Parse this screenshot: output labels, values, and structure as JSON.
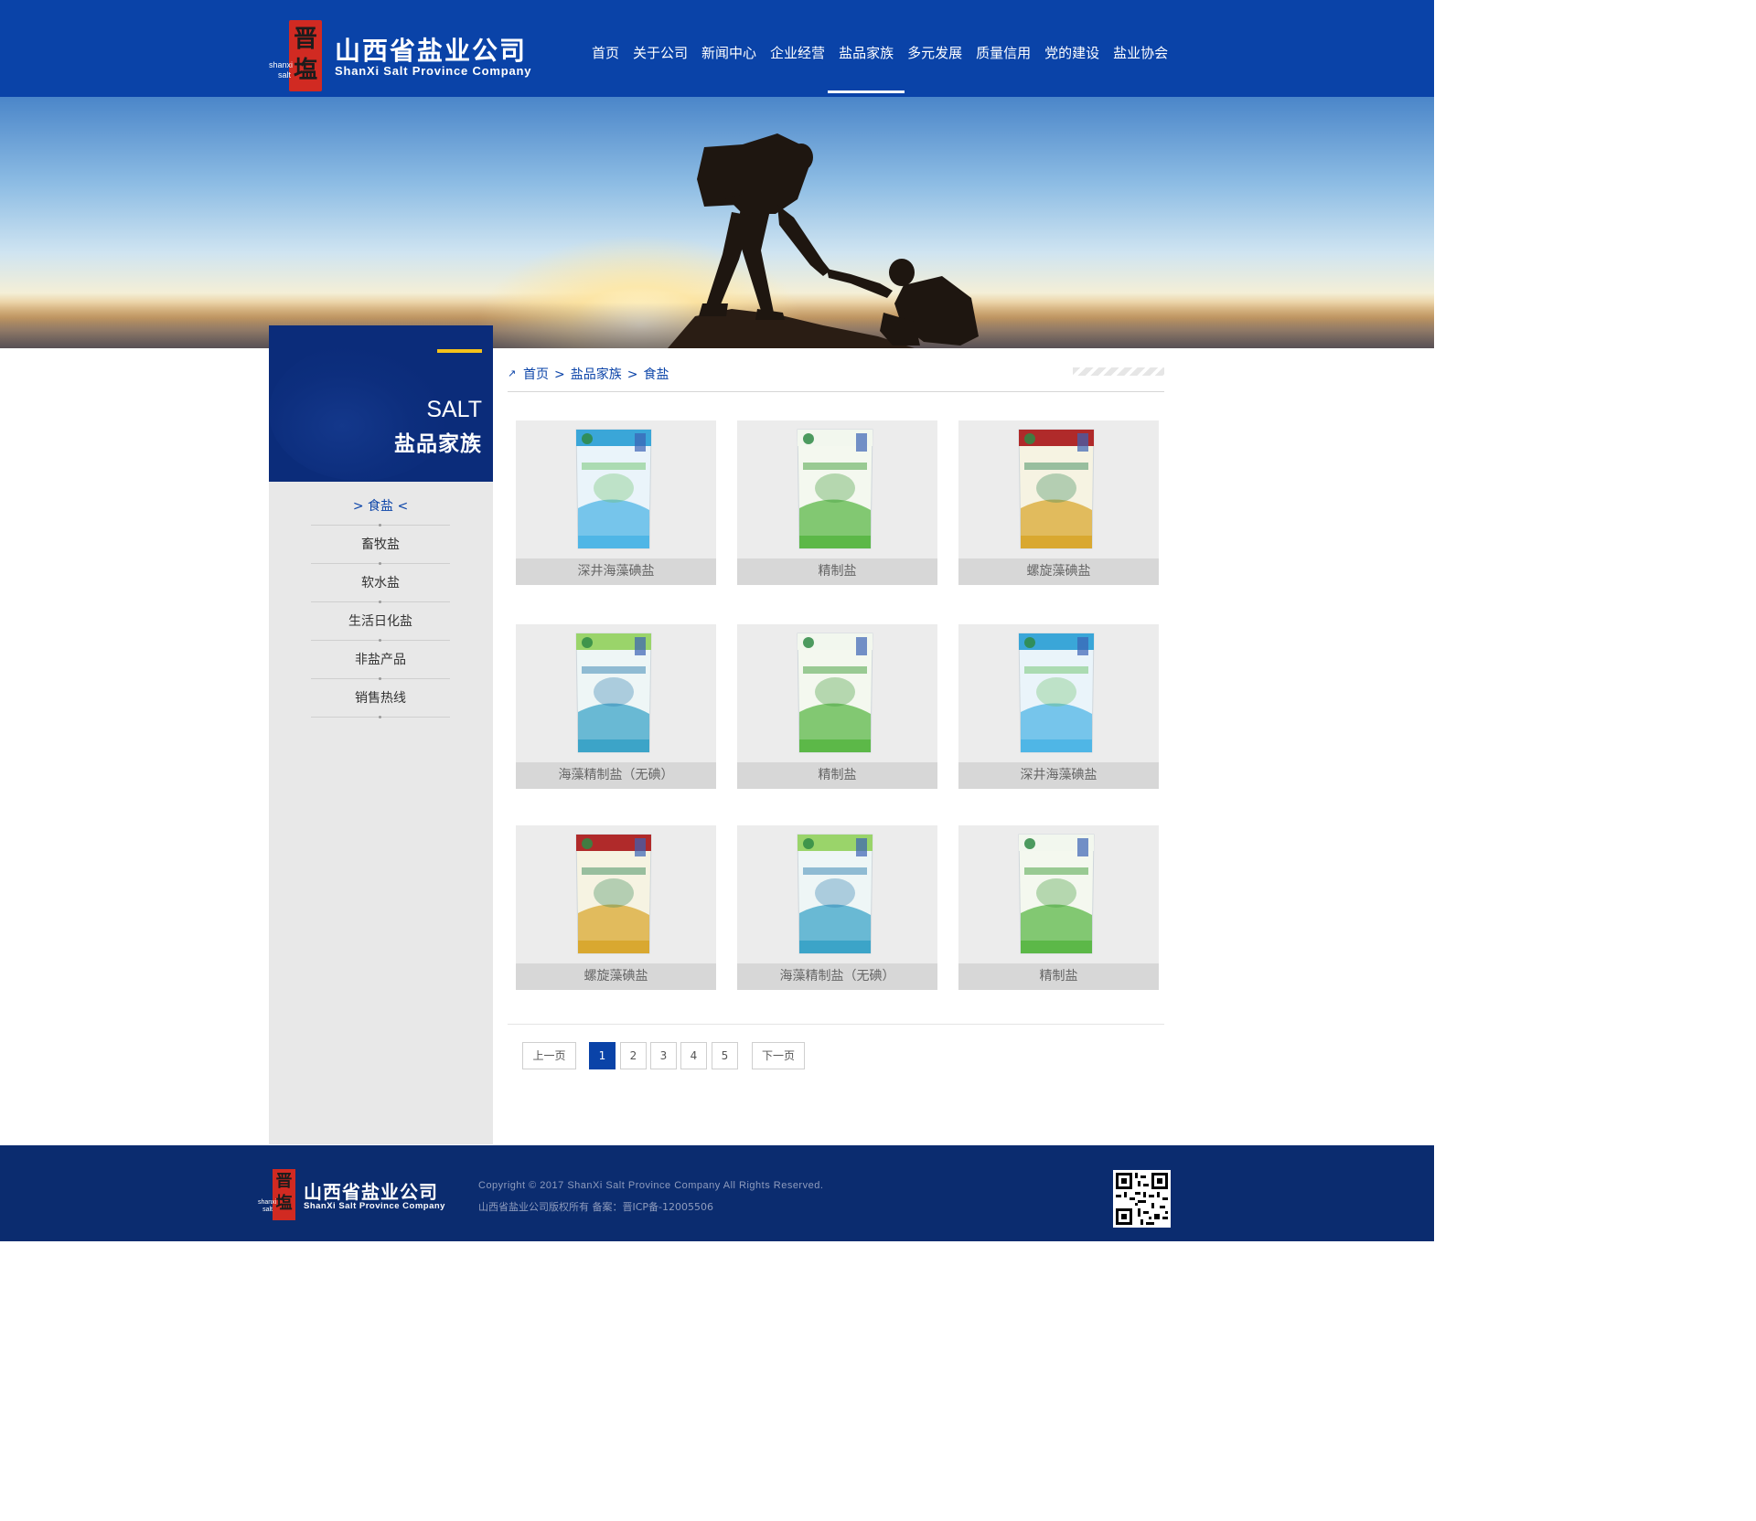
{
  "header": {
    "logo_seal": "晋塩",
    "logo_side": "shanxi salt",
    "logo_cn": "山西省盐业公司",
    "logo_en": "ShanXi Salt Province Company",
    "nav": [
      "首页",
      "关于公司",
      "新闻中心",
      "企业经营",
      "盐品家族",
      "多元发展",
      "质量信用",
      "党的建设",
      "盐业协会"
    ],
    "nav_active_index": 4
  },
  "sidebar": {
    "title_en": "SALT",
    "title_cn": "盐品家族",
    "items": [
      "食盐",
      "畜牧盐",
      "软水盐",
      "生活日化盐",
      "非盐产品",
      "销售热线"
    ],
    "active_index": 0
  },
  "breadcrumb": {
    "items": [
      "首页",
      "盐品家族",
      "食盐"
    ],
    "separator": ">"
  },
  "products": [
    {
      "name": "深井海藻碘盐",
      "pack": "blue"
    },
    {
      "name": "精制盐",
      "pack": "green"
    },
    {
      "name": "螺旋藻碘盐",
      "pack": "gold"
    },
    {
      "name": "海藻精制盐（无碘）",
      "pack": "sea"
    },
    {
      "name": "精制盐",
      "pack": "green"
    },
    {
      "name": "深井海藻碘盐",
      "pack": "blue"
    },
    {
      "name": "螺旋藻碘盐",
      "pack": "gold"
    },
    {
      "name": "海藻精制盐（无碘）",
      "pack": "sea"
    },
    {
      "name": "精制盐",
      "pack": "green"
    }
  ],
  "pagination": {
    "prev": "上一页",
    "next": "下一页",
    "pages": [
      "1",
      "2",
      "3",
      "4",
      "5"
    ],
    "current": "1"
  },
  "footer": {
    "logo_seal": "晋塩",
    "logo_side": "shanxi salt",
    "logo_cn": "山西省盐业公司",
    "logo_en": "ShanXi Salt Province Company",
    "copyright": "Copyright © 2017 ShanXi Salt Province Company All Rights Reserved.",
    "icp": "山西省盐业公司版权所有   备案：晋ICP备-12005506"
  },
  "colors": {
    "brand_blue": "#0a43a8",
    "sidebar_navy": "#0b2c7a",
    "accent_yellow": "#f5c21b",
    "footer_navy": "#0b2c6f",
    "seal_red": "#d12a22"
  }
}
